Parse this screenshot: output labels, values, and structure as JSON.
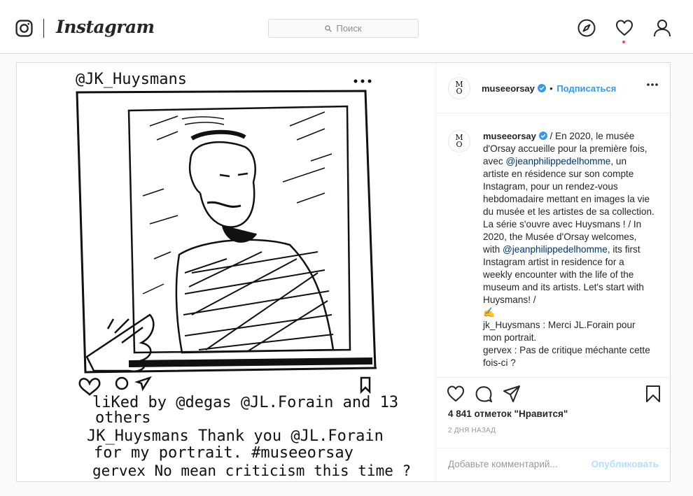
{
  "nav": {
    "wordmark": "Instagram",
    "search_placeholder": "Поиск",
    "icons": [
      "instagram-glyph-icon",
      "explore-compass-icon",
      "activity-heart-icon",
      "profile-user-icon"
    ],
    "notification_dot_color": "#ed4956"
  },
  "post": {
    "author": {
      "avatar_text_top": "M",
      "avatar_text_bottom": "O",
      "username": "museeorsay",
      "verified": true,
      "separator": "•",
      "follow_label": "Подписаться"
    },
    "drawing": {
      "handle": "@JK_Huysmans",
      "line1": "liKed by @degas @JL.Forain and 13",
      "line2": "others",
      "line3": "JK_Huysmans Thank you @JL.Forain",
      "line4": "for my portrait. #museeorsay",
      "line5": "gervex No mean criticism this time ?"
    },
    "caption": {
      "username": "museeorsay",
      "text_part1": "/ En 2020, le musée d'Orsay accueille pour la première fois, avec",
      "mention1": "@jeanphilippedelhomme",
      "text_part2": ", un artiste en résidence sur son compte Instagram, pour un rendez-vous hebdomadaire mettant en images la vie du musée et les artistes de sa collection. La série s'ouvre avec Huysmans ! / In 2020, the Musée d'Orsay welcomes, with",
      "mention2": "@jeanphilippedelhomme",
      "text_part3": ", its first Instagram artist in residence for a weekly encounter with the life of the museum and its artists. Let's start with Huysmans! /",
      "emoji": "✍️",
      "line_a": "jk_Huysmans : Merci JL.Forain pour mon portrait.",
      "line_b": "gervex : Pas de critique méchante cette fois-ci ?"
    },
    "likes": "4 841 отметок \"Нравится\"",
    "time_ago": "2 ДНЯ НАЗАД",
    "comment_placeholder": "Добавьте комментарий...",
    "publish_label": "Опубликовать"
  }
}
